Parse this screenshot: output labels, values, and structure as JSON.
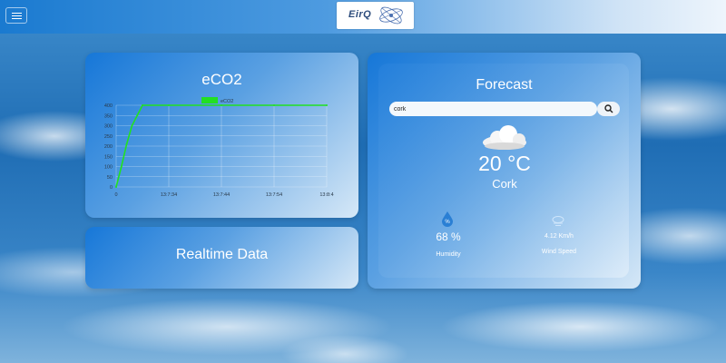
{
  "header": {
    "menu_icon": "hamburger-menu-icon",
    "logo_text": "EirQ"
  },
  "eco2_card": {
    "title": "eCO2"
  },
  "realtime_card": {
    "title": "Realtime Data"
  },
  "forecast": {
    "title": "Forecast",
    "search_value": "cork",
    "search_icon": "search-icon",
    "weather_icon": "cloud-icon",
    "temperature": "20 °C",
    "city": "Cork",
    "humidity_icon": "water-drop-percent-icon",
    "humidity_value": "68 %",
    "humidity_label": "Humidity",
    "wind_icon": "wind-cloud-icon",
    "wind_value": "4.12 Km/h",
    "wind_label": "Wind Speed"
  },
  "chart_data": {
    "type": "line",
    "legend": [
      "eCO2"
    ],
    "x_ticks": [
      "0",
      "13:7:34",
      "13:7:44",
      "13:7:54",
      "13:8:4"
    ],
    "y_ticks": [
      "0",
      "50",
      "100",
      "150",
      "200",
      "250",
      "300",
      "350",
      "400"
    ],
    "ylim": [
      0,
      400
    ],
    "series": [
      {
        "name": "eCO2",
        "color": "#22e022",
        "points": [
          [
            0,
            0
          ],
          [
            1,
            100
          ],
          [
            2,
            210
          ],
          [
            3,
            300
          ],
          [
            4,
            350
          ],
          [
            5,
            400
          ],
          [
            10,
            400
          ],
          [
            20,
            400
          ],
          [
            30,
            400
          ],
          [
            40,
            400
          ]
        ]
      }
    ]
  }
}
